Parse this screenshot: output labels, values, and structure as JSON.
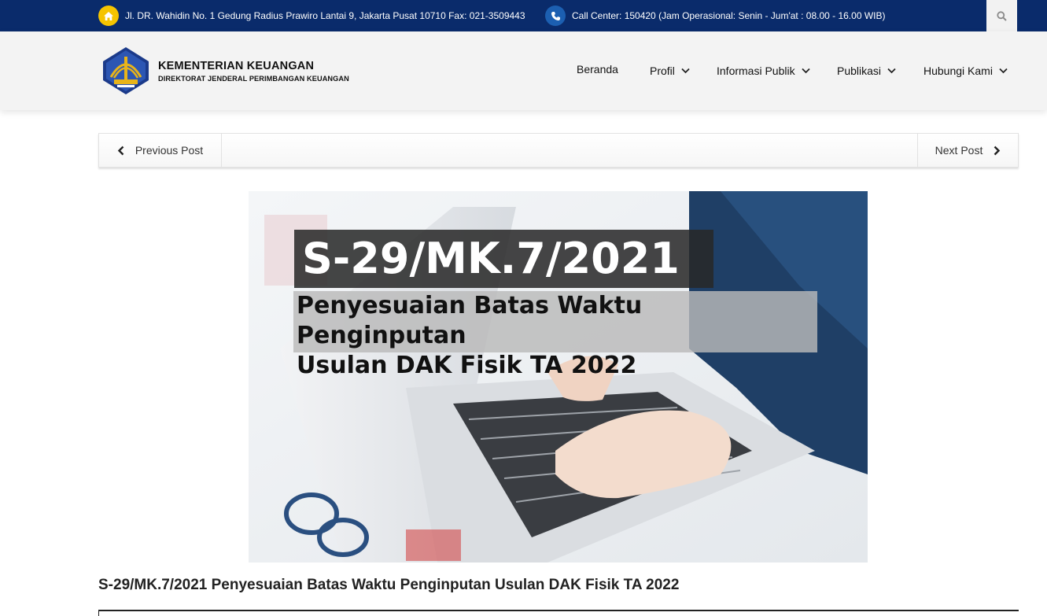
{
  "topbar": {
    "address": "Jl. DR. Wahidin No. 1 Gedung Radius Prawiro Lantai 9, Jakarta Pusat 10710 Fax: 021-3509443",
    "call_center": "Call Center: 150420 (Jam Operasional: Senin - Jum'at : 08.00 - 16.00 WIB)",
    "home_icon": "home-icon",
    "phone_icon": "phone-icon",
    "search_icon": "search-icon"
  },
  "header": {
    "logo_title": "KEMENTERIAN KEUANGAN",
    "logo_subtitle": "DIREKTORAT JENDERAL PERIMBANGAN KEUANGAN",
    "nav": [
      {
        "label": "Beranda"
      },
      {
        "label": "Profil"
      },
      {
        "label": "Informasi Publik"
      },
      {
        "label": "Publikasi"
      },
      {
        "label": "Hubungi Kami"
      }
    ]
  },
  "post_nav": {
    "previous": "Previous Post",
    "next": "Next Post"
  },
  "hero": {
    "headline": "S-29/MK.7/2021",
    "subheadline_line1": "Penyesuaian Batas Waktu Penginputan",
    "subheadline_line2": "Usulan DAK Fisik TA 2022"
  },
  "post": {
    "title": "S-29/MK.7/2021 Penyesuaian Batas Waktu Penginputan Usulan DAK Fisik TA 2022"
  },
  "colors": {
    "topbar_bg": "#0a2b6b",
    "home_badge": "#f5c400",
    "phone_badge": "#1c5fb1",
    "header_bg": "#f3f3f3",
    "logo_navy": "#1b3a8a",
    "logo_gold": "#e8b41a"
  }
}
